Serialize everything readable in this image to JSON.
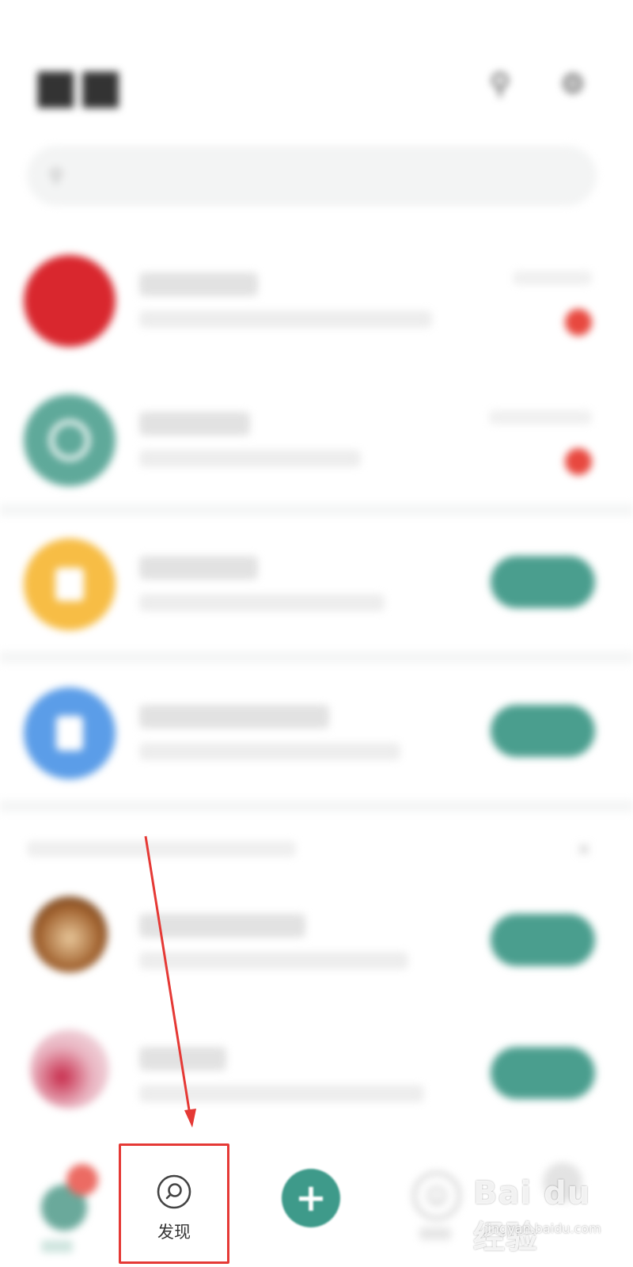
{
  "bottom_nav": {
    "discover_label": "发现"
  },
  "watermark": {
    "brand": "Bai du 经验",
    "url": "jingyan.baidu.com"
  },
  "colors": {
    "accent": "#3e9a8a",
    "highlight": "#e53935",
    "badge": "#e8483f",
    "avatar_red": "#d9272e",
    "avatar_teal": "#5fa99a",
    "avatar_yellow": "#f7bd45",
    "avatar_blue": "#5b9de8"
  },
  "icons": {
    "discover": "compass-search-icon",
    "fab": "plus-icon",
    "contacts": "contacts-icon",
    "settings": "gear-icon",
    "search": "search-icon"
  }
}
